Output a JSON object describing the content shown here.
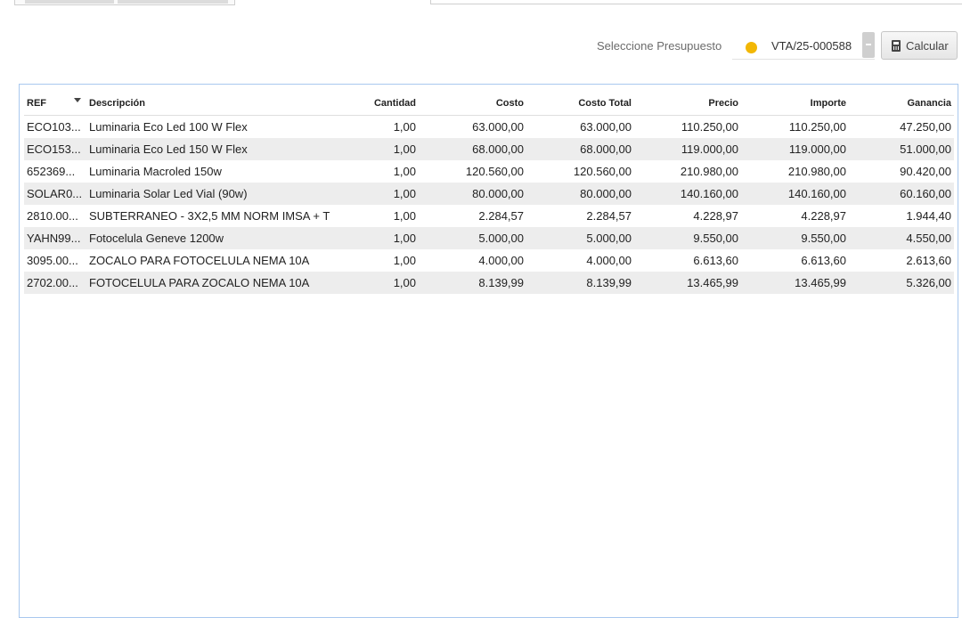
{
  "toolbar": {
    "selector_label": "Seleccione Presupuesto",
    "selected_budget": "VTA/25-000588",
    "status_color": "#f2b705",
    "calc_icon": "calculator-icon",
    "calc_label": "Calcular"
  },
  "table": {
    "headers": [
      "REF",
      "Descripción",
      "Cantidad",
      "Costo",
      "Costo Total",
      "Precio",
      "Importe",
      "Ganancia"
    ],
    "rows": [
      [
        "ECO103...",
        "Luminaria Eco Led 100 W Flex",
        "1,00",
        "63.000,00",
        "63.000,00",
        "110.250,00",
        "110.250,00",
        "47.250,00"
      ],
      [
        "ECO153...",
        "Luminaria Eco Led 150 W Flex",
        "1,00",
        "68.000,00",
        "68.000,00",
        "119.000,00",
        "119.000,00",
        "51.000,00"
      ],
      [
        "652369...",
        "Luminaria Macroled 150w",
        "1,00",
        "120.560,00",
        "120.560,00",
        "210.980,00",
        "210.980,00",
        "90.420,00"
      ],
      [
        "SOLAR0...",
        "Luminaria Solar Led Vial (90w)",
        "1,00",
        "80.000,00",
        "80.000,00",
        "140.160,00",
        "140.160,00",
        "60.160,00"
      ],
      [
        "2810.00...",
        "SUBTERRANEO - 3X2,5 MM NORM IMSA + T",
        "1,00",
        "2.284,57",
        "2.284,57",
        "4.228,97",
        "4.228,97",
        "1.944,40"
      ],
      [
        "YAHN99...",
        "Fotocelula Geneve 1200w",
        "1,00",
        "5.000,00",
        "5.000,00",
        "9.550,00",
        "9.550,00",
        "4.550,00"
      ],
      [
        "3095.00...",
        "ZOCALO PARA FOTOCELULA NEMA 10A",
        "1,00",
        "4.000,00",
        "4.000,00",
        "6.613,60",
        "6.613,60",
        "2.613,60"
      ],
      [
        "2702.00...",
        "FOTOCELULA PARA ZOCALO NEMA 10A",
        "1,00",
        "8.139,99",
        "8.139,99",
        "13.465,99",
        "13.465,99",
        "5.326,00"
      ]
    ]
  }
}
